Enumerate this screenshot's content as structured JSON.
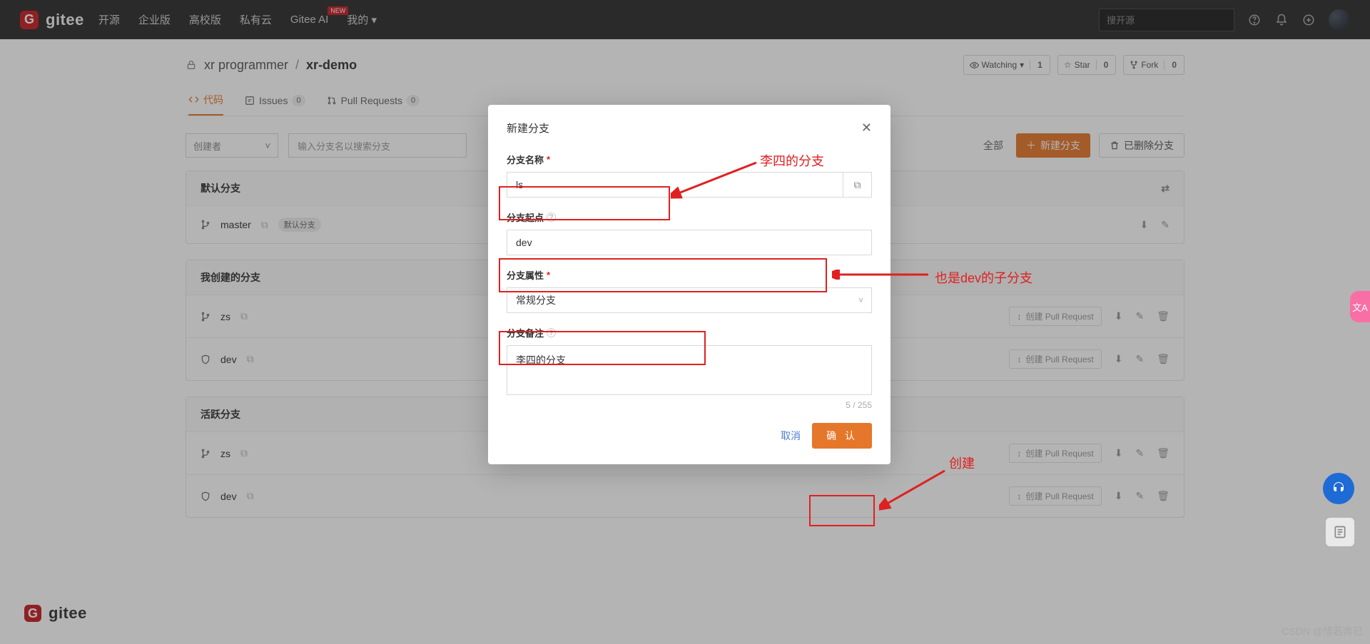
{
  "nav": {
    "brand": "gitee",
    "links": [
      "开源",
      "企业版",
      "高校版",
      "私有云",
      "Gitee AI",
      "我的"
    ],
    "new_badge": "NEW",
    "search_placeholder": "搜开源"
  },
  "breadcrumb": {
    "owner": "xr programmer",
    "sep": "/",
    "repo": "xr-demo"
  },
  "stats": {
    "watch_label": "Watching",
    "watch_count": "1",
    "star_label": "Star",
    "star_count": "0",
    "fork_label": "Fork",
    "fork_count": "0"
  },
  "tabs": {
    "code": "代码",
    "issues_label": "Issues",
    "issues_count": "0",
    "pr_label": "Pull Requests",
    "pr_count": "0"
  },
  "toolbar": {
    "creator": "创建者",
    "search_placeholder": "输入分支名以搜索分支",
    "all": "全部",
    "new_branch": "新建分支",
    "deleted": "已删除分支"
  },
  "panels": {
    "default_header": "默认分支",
    "mine_header": "我创建的分支",
    "active_header": "活跃分支",
    "default_tag": "默认分支",
    "pr_btn": "创建 Pull Request"
  },
  "branches": {
    "master": "master",
    "zs": "zs",
    "dev": "dev"
  },
  "modal": {
    "title": "新建分支",
    "name_label": "分支名称",
    "name_value": "ls",
    "start_label": "分支起点",
    "start_value": "dev",
    "attr_label": "分支属性",
    "attr_value": "常规分支",
    "note_label": "分支备注",
    "note_value": "李四的分支",
    "char_count": "5 / 255",
    "cancel": "取消",
    "confirm": "确 认"
  },
  "annotations": {
    "a1": "李四的分支",
    "a2": "也是dev的子分支",
    "a3": "创建"
  },
  "footer_brand": "gitee",
  "watermark": "CSDN @惜若奔已"
}
